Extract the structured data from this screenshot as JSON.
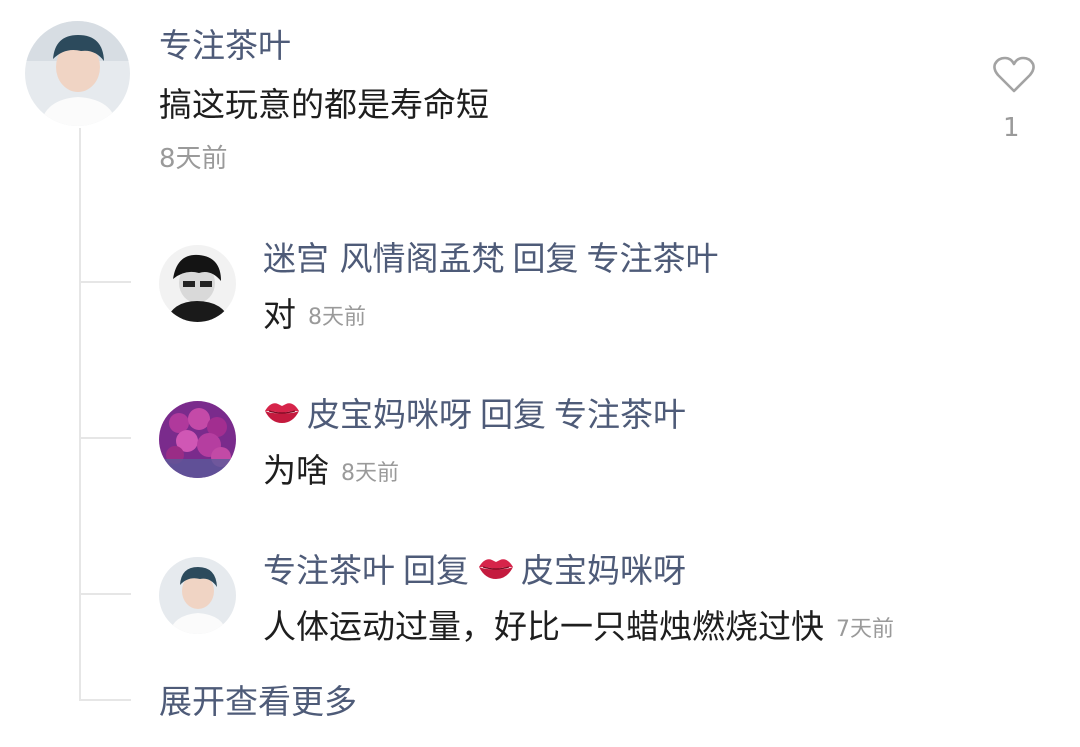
{
  "comment": {
    "author": "专注茶叶",
    "text": "搞这玩意的都是寿命短",
    "time": "8天前",
    "like_count": "1"
  },
  "replies": [
    {
      "author": "迷宫 风情阁孟梵",
      "reply_word": "回复",
      "target": "专注茶叶",
      "text": "对",
      "time": "8天前"
    },
    {
      "author": "皮宝妈咪呀",
      "reply_word": "回复",
      "target": "专注茶叶",
      "text": "为啥",
      "time": "8天前"
    },
    {
      "author": "专注茶叶",
      "reply_word": "回复",
      "target": "皮宝妈咪呀",
      "text": "人体运动过量，好比一只蜡烛燃烧过快",
      "time": "7天前"
    }
  ],
  "expand_label": "展开查看更多",
  "icons": {
    "like": "heart-outline-icon",
    "lips": "lips-icon"
  },
  "colors": {
    "name": "#4e5b78",
    "text": "#1e1e1e",
    "time": "#9a9a9a",
    "line": "#e6e6e6"
  }
}
